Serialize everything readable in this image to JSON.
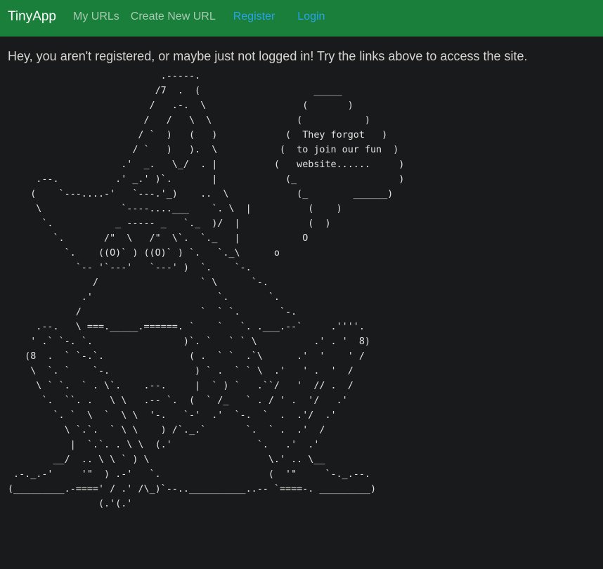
{
  "navbar": {
    "brand": "TinyApp",
    "links": {
      "my_urls": "My URLs",
      "create_new_url": "Create New URL",
      "register": "Register",
      "login": "Login"
    }
  },
  "main": {
    "message": "Hey, you aren't registered, or maybe just not logged in! Try the links above to access the site.",
    "ascii_art": "                           .-----.\n                          /7  .  (                    _____\n                         /   .-.  \\                 (       )\n                        /   /   \\  \\               (           )\n                       / `  )   (   )            (  They forgot   )\n                      / `   )   ).  \\           (  to join our fun  )\n                    .'  _.   \\_/  . |          (   website......     )\n     .--.          .' _.' )`.       |            (_                  )\n    (    `---....-'   `---.'_)    ..  \\            (_        ______)\n     \\              `----....___    `. \\  |          (    )\n      `.           _ ----- _   `._  )/  |            (  )\n        `.       /\"  \\   /\"  \\`.  `._   |           O\n          `.    ((O)` ) ((O)` ) `.   `._\\      o\n            `-- '`---'   `---' )  `.    `-.\n               /                  ` \\      `-.\n             .'                      `.       `.\n            /                     `  ` `.       `-.\n     .--.   \\ ===._____.======. `    `   `. .___.--`     .''''.\n    ' .` `-. `.                )`. `   ` ` \\          .' . '  8)\n   (8  .  ` `-.`.               ( .  ` `  .`\\      .'  '    ' /\n    \\  `. `    `-.               ) ` .  ` ` \\  .'   ' .  '  /\n     \\ ` `.  ` . \\`.    .--.     |  ` ) `   .``/   '  // .  /\n      `.  ``. .   \\ \\   .-- `.  (  ` /_   ` . / ' .  '/   .'\n        `. `  \\  `  \\ \\  '-.   `-'  .'  `-.  `  .  .'/  .'\n          \\ `.`.  ` \\ \\    ) /`._.`       `.  ` .  .'  /\n           |  `.`. . \\ \\  (.'               `.   .'  .'\n        __/  .. \\ \\ ` ) \\                     \\.' .. \\__\n .-._.-'     '\"  ) .-'   `.                   (  '\"     `-._.--.\n(_________.-====' / .' /\\_)`--..__________..-- `====-. _________)\n                (.'(.'"
  }
}
